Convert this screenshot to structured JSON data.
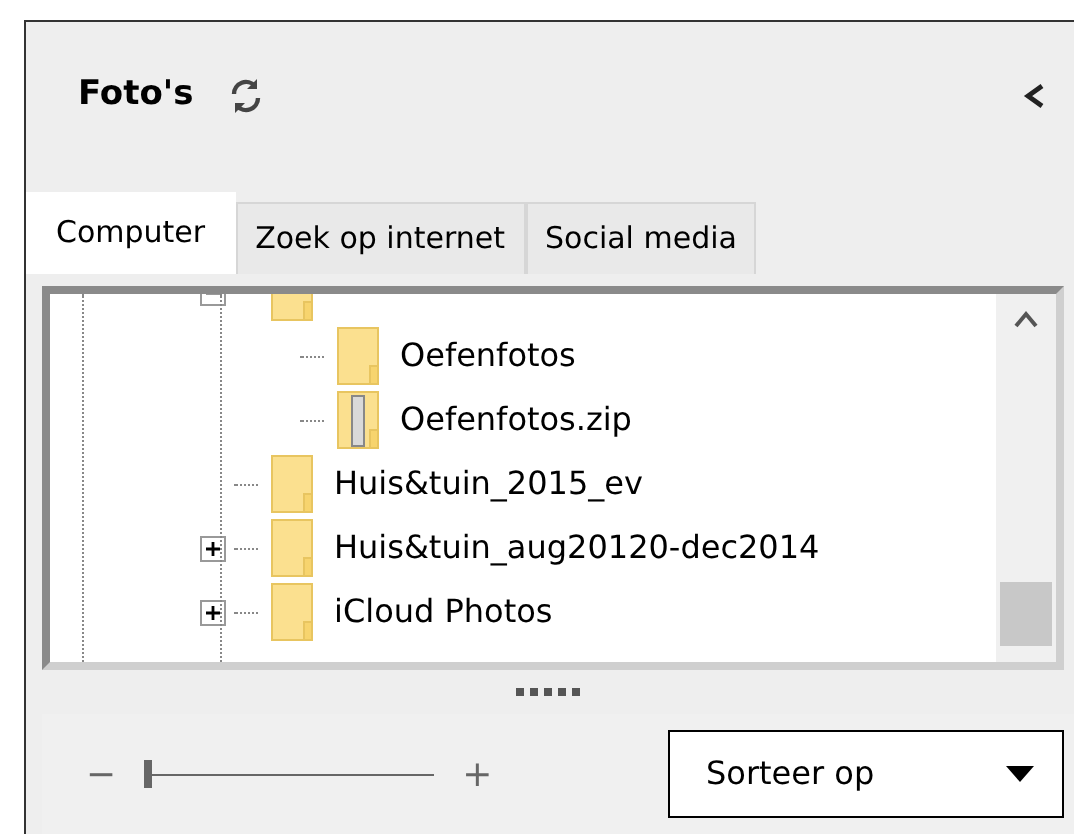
{
  "panel": {
    "title": "Foto's"
  },
  "tabs": [
    {
      "label": "Computer",
      "selected": true
    },
    {
      "label": "Zoek op internet",
      "selected": false
    },
    {
      "label": "Social media",
      "selected": false
    }
  ],
  "tree": {
    "items": [
      {
        "kind": "folder",
        "expanded": true,
        "children": [
          {
            "label": "Oefenfotos",
            "kind": "folder"
          },
          {
            "label": "Oefenfotos.zip",
            "kind": "zip"
          }
        ]
      },
      {
        "label": "Huis&tuin_2015_ev",
        "kind": "folder"
      },
      {
        "label": "Huis&tuin_aug20120-dec2014",
        "kind": "folder",
        "expanded": false
      },
      {
        "label": "iCloud Photos",
        "kind": "folder",
        "expanded": false
      }
    ]
  },
  "zoom": {
    "minus": "−",
    "plus": "+",
    "level": 0
  },
  "sort": {
    "label": "Sorteer op"
  }
}
